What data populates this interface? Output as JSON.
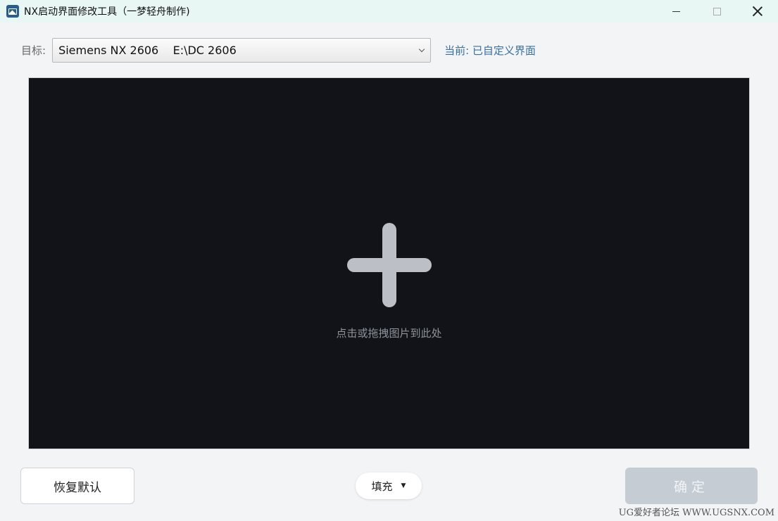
{
  "window": {
    "title": "NX启动界面修改工具（一梦轻舟制作)"
  },
  "target": {
    "label": "目标:",
    "selected": "Siemens NX 2606    E:\\DC 2606",
    "current": "当前: 已自定义界面"
  },
  "drop_zone": {
    "hint": "点击或拖拽图片到此处"
  },
  "footer": {
    "restore_label": "恢复默认",
    "fill_mode": "填充",
    "confirm_label": "确定"
  },
  "watermark": "UG爱好者论坛 WWW.UGSNX.COM",
  "colors": {
    "title_bar": "#e8f6f4",
    "drop_zone_bg": "#111318",
    "accent_text": "#3a6fa0",
    "confirm_disabled": "#c6ccd3"
  }
}
